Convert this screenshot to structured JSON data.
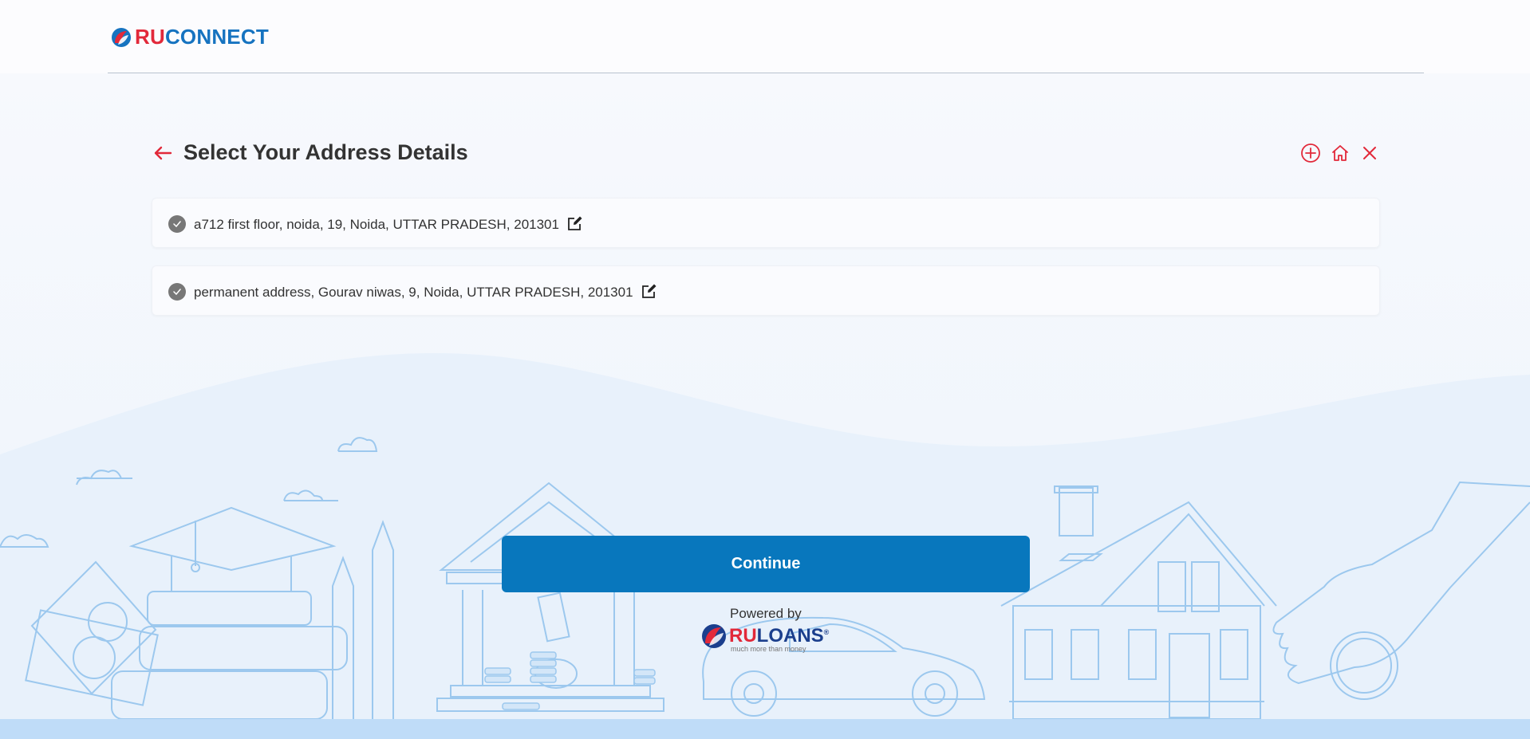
{
  "brand": {
    "logo_ru": "RU",
    "logo_rest": "CONNECT"
  },
  "page": {
    "title": "Select Your Address Details"
  },
  "addresses": [
    {
      "text": "a712 first floor, noida, 19, Noida, UTTAR PRADESH, 201301"
    },
    {
      "text": "permanent address, Gourav niwas, 9, Noida, UTTAR PRADESH, 201301"
    }
  ],
  "actions": {
    "continue_label": "Continue"
  },
  "footer": {
    "powered_by": "Powered by",
    "partner_ru": "RU",
    "partner_rest": "LOANS",
    "partner_registered": "®",
    "partner_tagline": "much more than money"
  },
  "icons": {
    "back": "arrow-left-icon",
    "add": "plus-circle-icon",
    "home": "home-icon",
    "close": "close-icon",
    "radio": "check-circle-icon",
    "edit": "edit-icon"
  },
  "colors": {
    "accent": "#e2293a",
    "primary": "#0877bd",
    "brand_blue": "#1673c0",
    "illustration": "#9cc8ee"
  }
}
